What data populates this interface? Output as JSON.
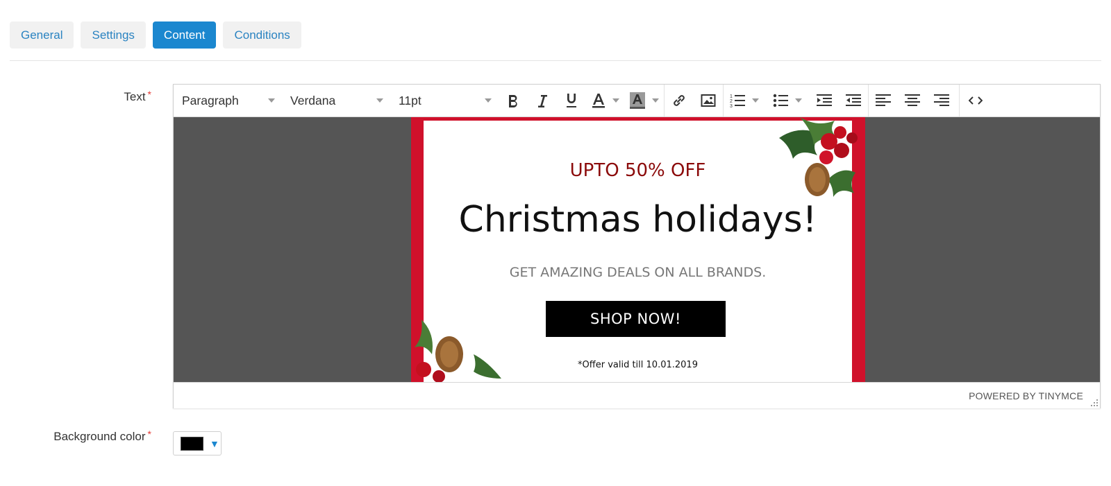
{
  "tabs": [
    {
      "label": "General",
      "active": false
    },
    {
      "label": "Settings",
      "active": false
    },
    {
      "label": "Content",
      "active": true
    },
    {
      "label": "Conditions",
      "active": false
    }
  ],
  "fields": {
    "text_label": "Text",
    "text_required": "*",
    "bg_label": "Background color",
    "bg_required": "*"
  },
  "editor": {
    "block_format": "Paragraph",
    "font_family": "Verdana",
    "font_size": "11pt",
    "toolbar_icons": [
      "bold-icon",
      "italic-icon",
      "underline-icon",
      "text-color-icon",
      "background-color-icon",
      "link-icon",
      "image-icon",
      "numbered-list-icon",
      "bullet-list-icon",
      "indent-icon",
      "outdent-icon",
      "align-left-icon",
      "align-center-icon",
      "align-right-icon",
      "source-code-icon"
    ],
    "status": "POWERED BY TINYMCE"
  },
  "banner": {
    "offer": "UPTO 50% OFF",
    "headline": "Christmas holidays!",
    "subline": "GET AMAZING DEALS ON ALL BRANDS.",
    "button": "SHOP NOW!",
    "validity": "*Offer valid till 10.01.2019"
  },
  "background_color": {
    "value": "#000000",
    "dropdown_icon": "triangle-down-icon"
  },
  "colors": {
    "accent": "#1b87cf",
    "tab_text": "#2a83c1",
    "banner_border": "#d0112b",
    "offer_text": "#8b0a0a",
    "canvas": "#555555"
  }
}
